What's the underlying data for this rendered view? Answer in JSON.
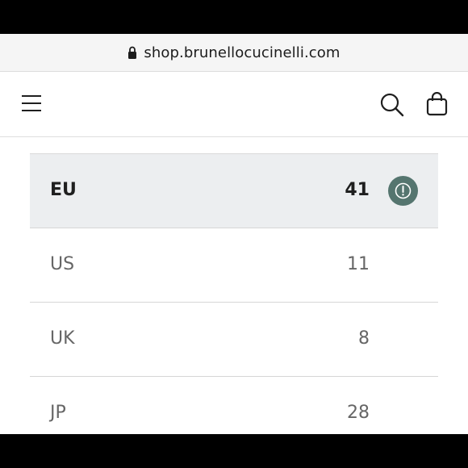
{
  "browser": {
    "url": "shop.brunellocucinelli.com"
  },
  "header": {
    "menu_icon": "hamburger-menu-icon",
    "search_icon": "search-icon",
    "bag_icon": "shopping-bag-icon"
  },
  "size_table": {
    "rows": [
      {
        "system": "EU",
        "value": "41",
        "selected": true
      },
      {
        "system": "US",
        "value": "11",
        "selected": false
      },
      {
        "system": "UK",
        "value": "8",
        "selected": false
      },
      {
        "system": "JP",
        "value": "28",
        "selected": false
      }
    ],
    "selected_badge_icon": "info-icon"
  },
  "colors": {
    "selected_row_bg": "#eceef0",
    "badge_bg": "#55756f",
    "muted_text": "#666666"
  }
}
